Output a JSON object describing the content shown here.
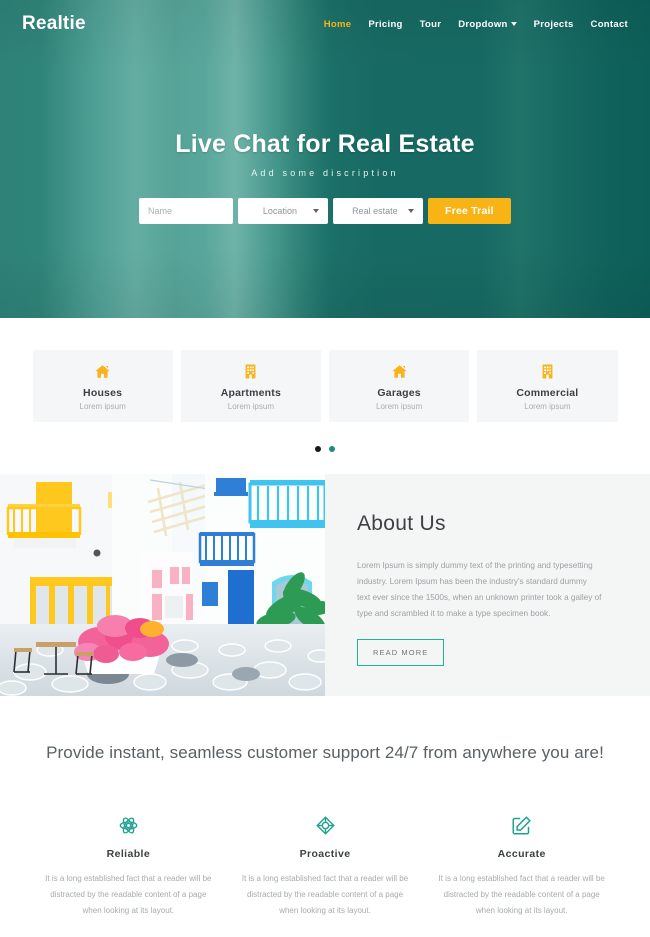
{
  "brand": "Realtie",
  "colors": {
    "accent_yellow": "#f8b314",
    "teal": "#1f8d7e",
    "teal_border": "#23b39b",
    "hero_dark": "#0f625b",
    "hero_light": "#6fb3a8"
  },
  "nav": {
    "items": [
      {
        "label": "Home",
        "active": true,
        "dropdown": false
      },
      {
        "label": "Pricing",
        "active": false,
        "dropdown": false
      },
      {
        "label": "Tour",
        "active": false,
        "dropdown": false
      },
      {
        "label": "Dropdown",
        "active": false,
        "dropdown": true
      },
      {
        "label": "Projects",
        "active": false,
        "dropdown": false
      },
      {
        "label": "Contact",
        "active": false,
        "dropdown": false
      }
    ]
  },
  "hero": {
    "title": "Live Chat for Real Estate",
    "subtitle": "Add some discription",
    "form": {
      "name_placeholder": "Name",
      "name_value": "",
      "location_label": "Location",
      "property_label": "Real estate",
      "submit_label": "Free Trail"
    }
  },
  "categories": {
    "cards": [
      {
        "icon": "house-icon",
        "title": "Houses",
        "subtitle": "Lorem ipsum"
      },
      {
        "icon": "apartment-building-icon",
        "title": "Apartments",
        "subtitle": "Lorem ipsum"
      },
      {
        "icon": "house-icon",
        "title": "Garages",
        "subtitle": "Lorem ipsum"
      },
      {
        "icon": "apartment-building-icon",
        "title": "Commercial",
        "subtitle": "Lorem ipsum"
      }
    ],
    "carousel_dots": [
      {
        "name": "carousel-dot-1",
        "active": true
      },
      {
        "name": "carousel-dot-2",
        "active": false
      }
    ]
  },
  "about": {
    "image_alt": "greek-island-street-with-yellow-and-blue-balconies",
    "title": "About Us",
    "body": "Lorem Ipsum is simply dummy text of the printing and typesetting industry. Lorem Ipsum has been the industry's standard dummy text ever since the 1500s, when an unknown printer took a galley of type and scrambled it to make a type specimen book.",
    "read_more_label": "READ MORE"
  },
  "support": {
    "title": "Provide instant, seamless customer support 24/7 from anywhere you are!",
    "features": [
      {
        "icon": "atom-icon",
        "title": "Reliable",
        "body": "It is a long established fact that a reader will be distracted by the readable content of a page when looking at its layout."
      },
      {
        "icon": "diamond-target-icon",
        "title": "Proactive",
        "body": "It is a long established fact that a reader will be distracted by the readable content of a page when looking at its layout."
      },
      {
        "icon": "edit-pencil-square-icon",
        "title": "Accurate",
        "body": "It is a long established fact that a reader will be distracted by the readable content of a page when looking at its layout."
      }
    ]
  }
}
